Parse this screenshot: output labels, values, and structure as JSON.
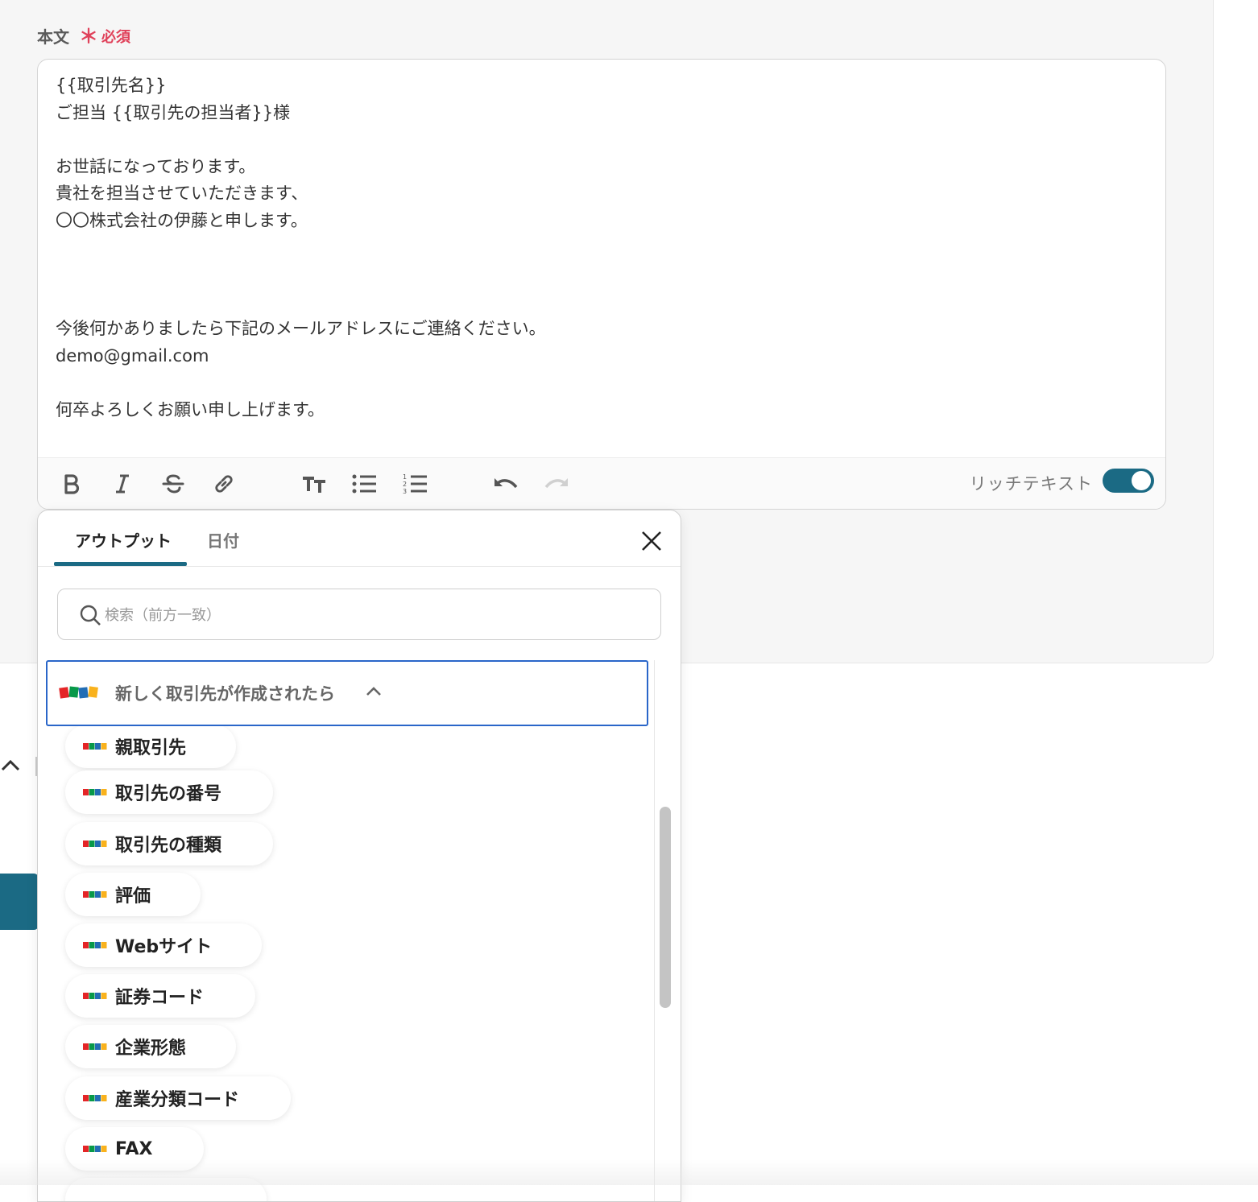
{
  "field": {
    "label": "本文",
    "required": "必須",
    "required_mark": "＊"
  },
  "editor": {
    "lines": [
      "{{取引先名}}",
      "ご担当 {{取引先の担当者}}様",
      "",
      "お世話になっております。",
      "貴社を担当させていただきます、",
      "〇〇株式会社の伊藤と申します。",
      "",
      "",
      "",
      "今後何かありましたら下記のメールアドレスにご連絡ください。",
      "demo@gmail.com",
      "",
      "何卒よろしくお願い申し上げます。"
    ],
    "rich_text_label": "リッチテキスト",
    "rich_text_enabled": true,
    "toolbar_icons": [
      "bold-icon",
      "italic-icon",
      "strikethrough-icon",
      "link-icon",
      "text-size-icon",
      "bullet-list-icon",
      "numbered-list-icon",
      "undo-icon",
      "redo-icon"
    ]
  },
  "popup": {
    "tabs": [
      {
        "label": "アウトプット",
        "active": true
      },
      {
        "label": "日付",
        "active": false
      }
    ],
    "search": {
      "placeholder": "検索（前方一致）",
      "value": ""
    },
    "group": {
      "title": "新しく取引先が作成されたら",
      "logo": "zoho-logo",
      "expanded": true
    },
    "items": [
      "親取引先",
      "取引先の番号",
      "取引先の種類",
      "評価",
      "Webサイト",
      "証券コード",
      "企業形態",
      "産業分類コード",
      "FAX"
    ]
  },
  "colors": {
    "accent": "#1b6a84",
    "required": "#e0415a",
    "focus_border": "#2a66c9"
  }
}
